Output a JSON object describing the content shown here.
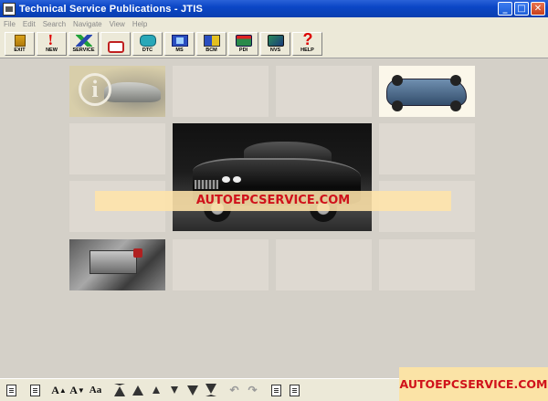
{
  "window": {
    "title": "Technical Service Publications  - JTIS"
  },
  "window_controls": {
    "minimize": "_",
    "maximize": "□",
    "close": "✕"
  },
  "menu": [
    "File",
    "Edit",
    "Search",
    "Navigate",
    "View",
    "Help"
  ],
  "toolbar": [
    {
      "label": "EXIT",
      "icon": "exit-icon"
    },
    {
      "label": "NEW",
      "icon": "new-icon"
    },
    {
      "label": "SERVICE",
      "icon": "service-icon"
    },
    {
      "label": "",
      "icon": "generic-document-icon"
    },
    {
      "label": "DTC",
      "icon": "dtc-icon"
    },
    {
      "label": "MS",
      "icon": "ms-icon"
    },
    {
      "label": "BCM",
      "icon": "bcm-icon"
    },
    {
      "label": "PDI",
      "icon": "pdi-icon"
    },
    {
      "label": "NVS",
      "icon": "nvs-icon"
    },
    {
      "label": "HELP",
      "icon": "help-icon"
    }
  ],
  "watermark": "AUTOEPCSERVICE.COM",
  "bottom_toolbar": {
    "font_larger": "A",
    "font_smaller": "A",
    "font_case": "Aa"
  }
}
